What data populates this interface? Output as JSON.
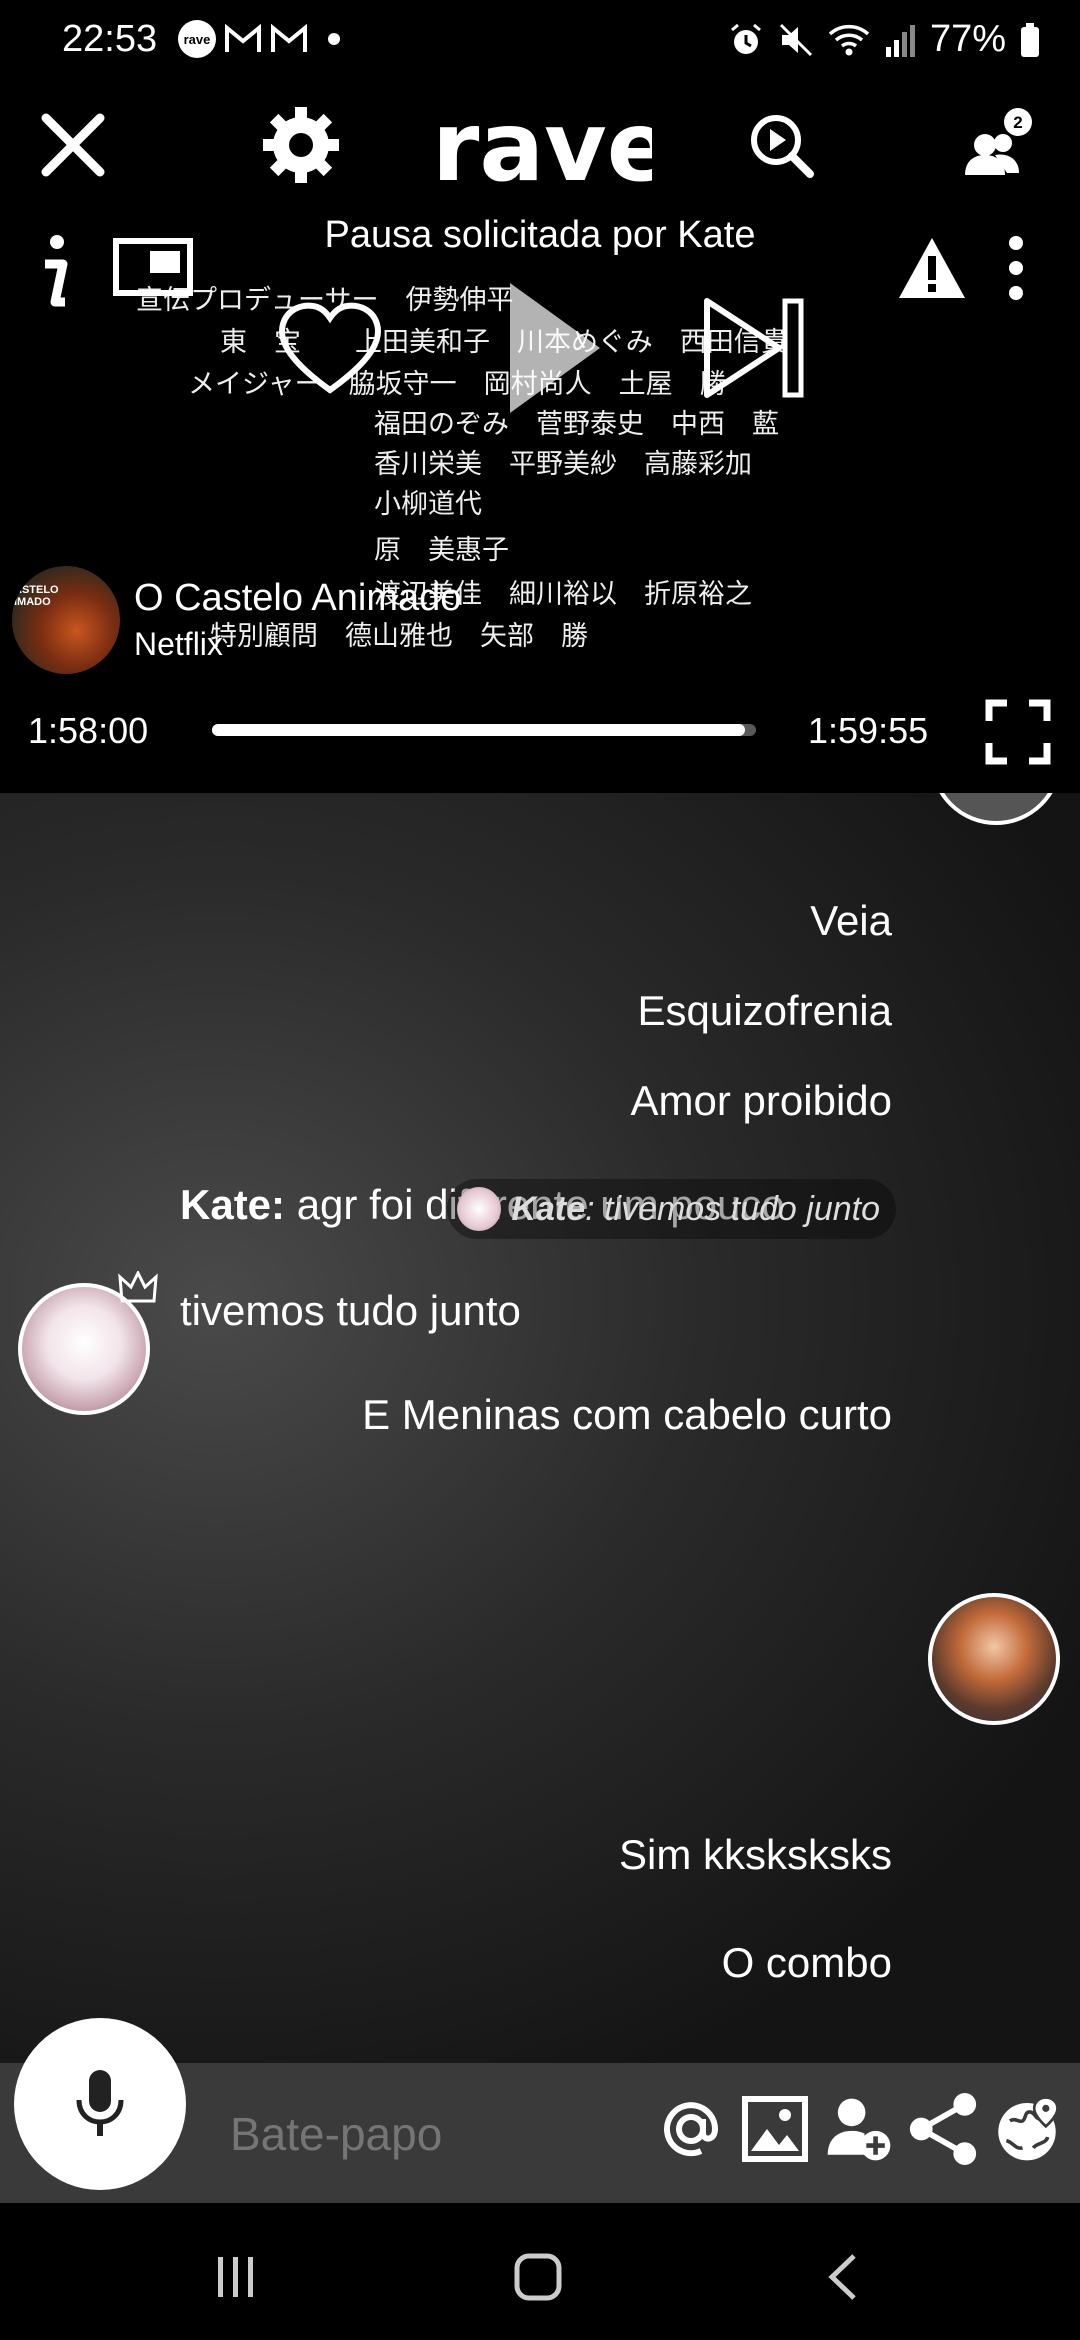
{
  "status_bar": {
    "time": "22:53",
    "battery": "77%",
    "icons": [
      "rave-icon",
      "gmail-icon",
      "gmail-icon",
      "dot-icon",
      "alarm-icon",
      "mute-icon",
      "wifi-icon",
      "signal-icon",
      "battery-icon"
    ]
  },
  "app_bar": {
    "logo": "rave",
    "icons": [
      "close-icon",
      "settings-icon",
      "search-play-icon",
      "users-icon"
    ],
    "users_badge": "2"
  },
  "player": {
    "pause_message": "Pausa solicitada por Kate",
    "title": "O Castelo Animado",
    "provider": "Netflix",
    "poster_text": "ASTELO\nIMADO",
    "current_time": "1:58:00",
    "total_time": "1:59:55",
    "progress": 0.98,
    "credits": [
      "宣伝プロデューサー　伊勢伸平",
      "東　宝　　上田美和子　川本めぐみ　西田信貴",
      "メイジャー　脇坂守一　岡村尚人　土屋　勝",
      "福田のぞみ　菅野泰史　中西　藍",
      "香川栄美　平野美紗　高藤彩加",
      "小柳道代",
      "原　美惠子",
      "渡辺美佳　細川裕以　折原裕之",
      "特別顧問　德山雅也　矢部　勝"
    ]
  },
  "chat": {
    "messages": [
      {
        "text": "Veia"
      },
      {
        "text": "Esquizofrenia"
      },
      {
        "text": "Amor proibido"
      },
      {
        "author": "Kate:",
        "text": "agr foi diferente um pouco"
      },
      {
        "text": "tivemos tudo junto"
      },
      {
        "text": "E Meninas com cabelo curto"
      },
      {
        "reply_author": "Kate",
        "reply_text": ": tivemos tudo junto",
        "text": "Sim kksksksks"
      },
      {
        "text": "O combo"
      }
    ]
  },
  "input_bar": {
    "placeholder": "Bate-papo",
    "icons": [
      "mention-icon",
      "image-icon",
      "add-user-icon",
      "share-icon",
      "globe-location-icon"
    ]
  },
  "nav_bar": {
    "icons": [
      "recents-icon",
      "home-icon",
      "back-icon"
    ]
  }
}
